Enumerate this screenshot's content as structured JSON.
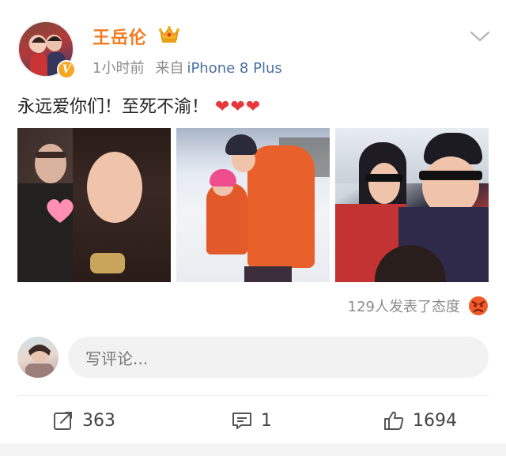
{
  "post": {
    "author": {
      "name": "王岳伦",
      "verified_badge": "V",
      "crown_icon": "crown-icon"
    },
    "time": "1小时前",
    "source_label": "来自",
    "source_device": "iPhone 8 Plus",
    "text": "永远爱你们！至死不渝！",
    "emoji": "❤❤❤",
    "photos": [
      {
        "alt": "couple-selfie"
      },
      {
        "alt": "ski-family"
      },
      {
        "alt": "yacht-selfie"
      }
    ],
    "reactions_text": "129人发表了态度",
    "reaction_icon": "angry-face-icon"
  },
  "comment_box": {
    "placeholder": "写评论..."
  },
  "actions": {
    "repost_count": "363",
    "comment_count": "1",
    "like_count": "1694"
  },
  "colors": {
    "username": "#f37a1f",
    "device_link": "#4a6fa5",
    "heart": "#e8373b",
    "verified": "#f5a623"
  }
}
